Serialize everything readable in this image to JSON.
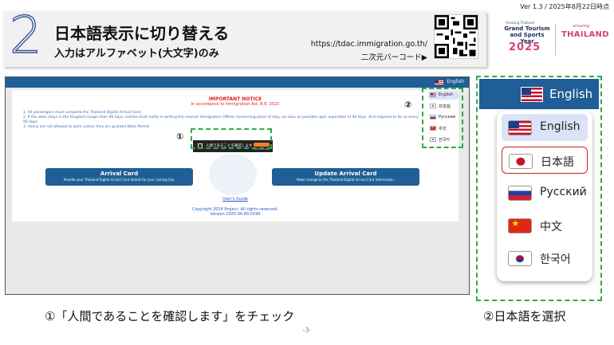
{
  "version_note": "Ver 1.3 / 2025年8月22日時点",
  "title": {
    "step_number": "2",
    "main": "日本語表示に切り替える",
    "sub": "入力はアルファベット(大文字)のみ",
    "url": "https://tdac.immigration.go.th/",
    "qr_caption": "二次元バーコード▶"
  },
  "logos": {
    "amazing_small": "Amazing Thailand",
    "grand_tourism": "Grand Tourism and Sports Year",
    "year": "2025",
    "amazing_script": "amazing",
    "thailand": "THAILAND"
  },
  "screenshot": {
    "header_lang": "English",
    "notice_title": "IMPORTANT NOTICE",
    "notice_subtitle": "In accordance to Immigration Act, B.E. 2522",
    "notice_items": [
      "1. All passengers must complete the Thailand Digital Arrival Card.",
      "2. If the alien stays in the Kingdom longer than 90 days, he/she must notify in writing the nearest Immigration Officer concerning place of stay, as soon as possible upon expiration of 90 days. And required to do so every 90 days.",
      "3. Aliens are not allowed to work unless they are granted Work Permit."
    ],
    "captcha_label": "人間であることを確認します",
    "captcha_brand": "CLOUDFLARE",
    "arrival_title": "Arrival Card",
    "arrival_desc": "Provide your Thailand Digital Arrival Card details for your coming trip.",
    "update_title": "Update Arrival Card",
    "update_desc": "Make change to the Thailand Digital Arrival Card information.",
    "guide_link": "User's Guide",
    "copyright": "Copyright 2024 Project. All rights reserved.",
    "version": "Version 2025.04.00-0299",
    "languages": [
      "English",
      "日本語",
      "Русский",
      "中文",
      "한국어"
    ]
  },
  "markers": {
    "one": "①",
    "two": "②"
  },
  "zoom": {
    "header_lang": "English",
    "languages": [
      {
        "label": "English",
        "flag": "us-flag-icon"
      },
      {
        "label": "日本語",
        "flag": "japan-flag-icon"
      },
      {
        "label": "Русский",
        "flag": "russia-flag-icon"
      },
      {
        "label": "中文",
        "flag": "china-flag-icon"
      },
      {
        "label": "한국어",
        "flag": "korea-flag-icon"
      }
    ]
  },
  "captions": {
    "left": "①「人間であることを確認します」をチェック",
    "right": "②日本語を選択"
  },
  "page_number": "-3-",
  "colors": {
    "primary": "#1f5e96",
    "highlight_green": "#2eaa4e",
    "highlight_red": "#d02020"
  }
}
